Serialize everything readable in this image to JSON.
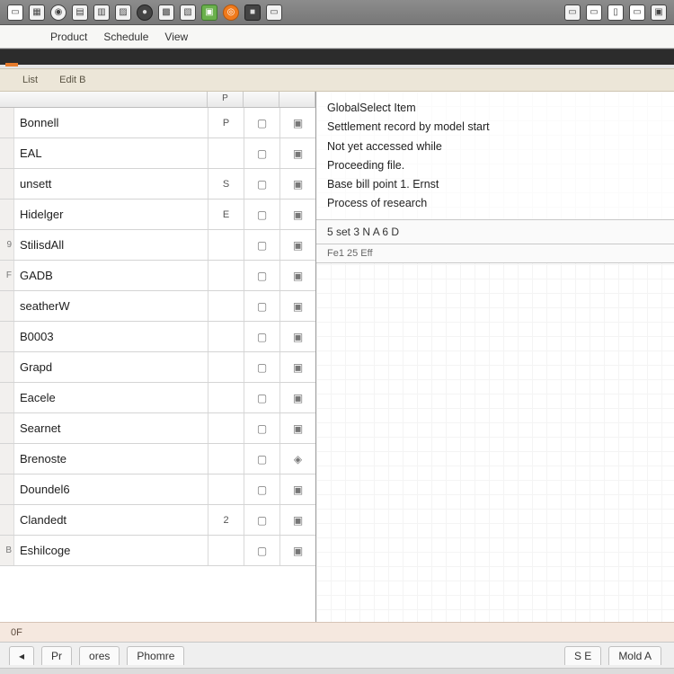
{
  "menubar": {
    "items": [
      "Product",
      "Schedule",
      "View"
    ]
  },
  "toolbar2": {
    "items": [
      "List",
      "Edit B"
    ]
  },
  "list": {
    "header": {
      "name": "",
      "c1": "P",
      "c2": "",
      "c3": ""
    },
    "rows": [
      {
        "num": "",
        "name": "Bonnell",
        "c1": "P",
        "icon": "▣"
      },
      {
        "num": "",
        "name": "EAL",
        "c1": "",
        "icon": "▣"
      },
      {
        "num": "",
        "name": "unsett",
        "c1": "S",
        "icon": "▣"
      },
      {
        "num": "",
        "name": "Hidelger",
        "c1": "E",
        "icon": "▣"
      },
      {
        "num": "9",
        "name": "StilisdAll",
        "c1": "",
        "icon": "▣"
      },
      {
        "num": "F",
        "name": "GADB",
        "c1": "",
        "icon": "▣"
      },
      {
        "num": "",
        "name": "seatherW",
        "c1": "",
        "icon": "▣"
      },
      {
        "num": "",
        "name": "B0003",
        "c1": "",
        "icon": "▣"
      },
      {
        "num": "",
        "name": "Grapd",
        "c1": "",
        "icon": "▣"
      },
      {
        "num": "",
        "name": "Eacele",
        "c1": "",
        "icon": "▣"
      },
      {
        "num": "",
        "name": "Searnet",
        "c1": "",
        "icon": "▣"
      },
      {
        "num": "",
        "name": "Brenoste",
        "c1": "",
        "icon": "◈"
      },
      {
        "num": "",
        "name": "Doundel6",
        "c1": "",
        "icon": "▣"
      },
      {
        "num": "",
        "name": "Clandedt",
        "c1": "2",
        "icon": "▣"
      },
      {
        "num": "B",
        "name": "Eshilcoge",
        "c1": "",
        "icon": "▣"
      }
    ]
  },
  "detail": {
    "lines": [
      "GlobalSelect Item",
      "Settlement record by model start",
      "Not yet accessed while",
      "Proceeding file.",
      "Base bill  point 1.  Ernst",
      "Process  of  research"
    ],
    "sub_fields": [
      "5  set 3  N  A  6  D"
    ],
    "sub2": "Fe1 25 Eff"
  },
  "bottom": {
    "label": "0F"
  },
  "tabs": {
    "items": [
      "Pr",
      "ores",
      "Phomre"
    ],
    "right_items": [
      "S E",
      "Mold A"
    ]
  }
}
